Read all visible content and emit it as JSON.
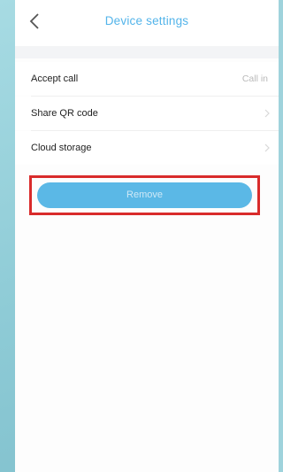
{
  "header": {
    "title": "Device settings"
  },
  "settings": [
    {
      "label": "Accept call",
      "value": "Call in"
    },
    {
      "label": "Share QR code",
      "value": ""
    },
    {
      "label": "Cloud storage",
      "value": ""
    }
  ],
  "actions": {
    "remove_label": "Remove"
  },
  "colors": {
    "accent": "#53b4ea",
    "button": "#5bb8e6",
    "highlight_border": "#d92b2b",
    "background": "#9fd3dc"
  },
  "icons": {
    "back": "chevron-left-icon",
    "row_arrow": "chevron-right-icon"
  }
}
